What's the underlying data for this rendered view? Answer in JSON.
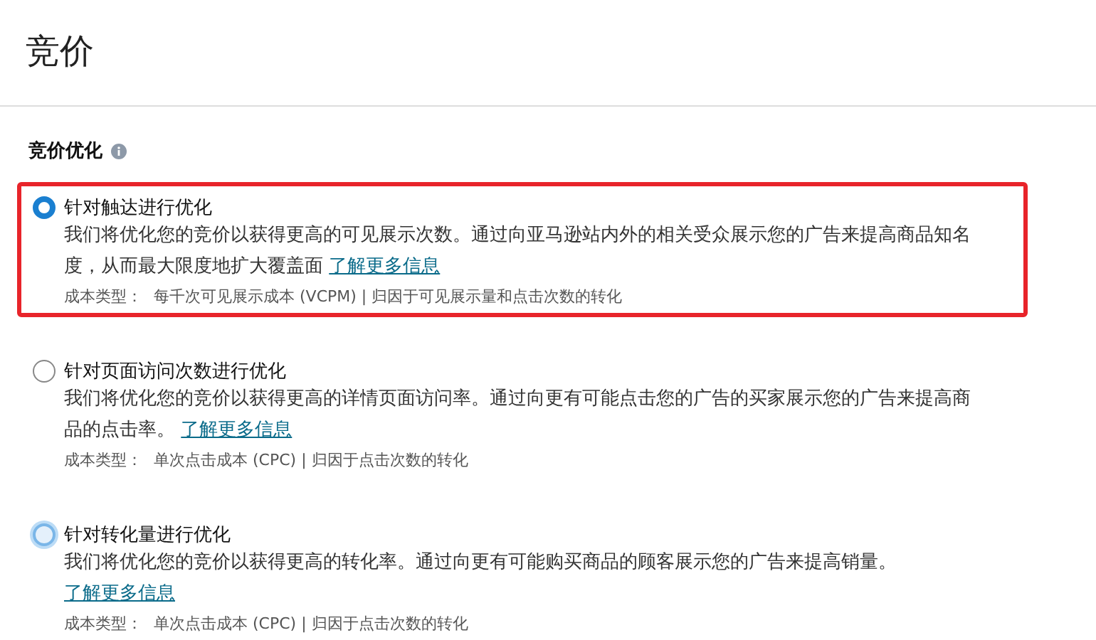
{
  "page_title": "竞价",
  "section": {
    "heading": "竞价优化"
  },
  "options": [
    {
      "label": "针对触达进行优化",
      "selected": true,
      "hovered": false,
      "highlighted": true,
      "description": "我们将优化您的竞价以获得更高的可见展示次数。通过向亚马逊站内外的相关受众展示您的广告来提高商品知名度，从而最大限度地扩大覆盖面",
      "link": "了解更多信息",
      "cost_label": "成本类型：",
      "cost": "每千次可见展示成本 (VCPM) | 归因于可见展示量和点击次数的转化"
    },
    {
      "label": "针对页面访问次数进行优化",
      "selected": false,
      "hovered": false,
      "highlighted": false,
      "description": "我们将优化您的竞价以获得更高的详情页面访问率。通过向更有可能点击您的广告的买家展示您的广告来提高商品的点击率。",
      "link": "了解更多信息",
      "cost_label": "成本类型：",
      "cost": "单次点击成本 (CPC) | 归因于点击次数的转化"
    },
    {
      "label": "针对转化量进行优化",
      "selected": false,
      "hovered": true,
      "highlighted": false,
      "description": "我们将优化您的竞价以获得更高的转化率。通过向更有可能购买商品的顾客展示您的广告来提高销量。",
      "link": "了解更多信息",
      "cost_label": "成本类型：",
      "cost": "单次点击成本 (CPC) | 归因于点击次数的转化"
    }
  ]
}
